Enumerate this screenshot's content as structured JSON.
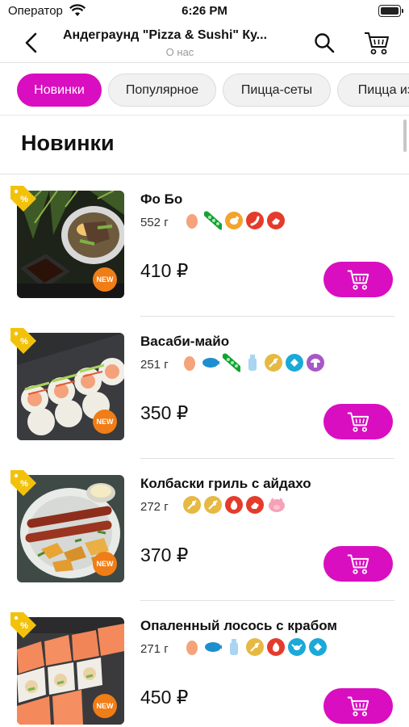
{
  "status_bar": {
    "carrier": "Оператор",
    "time": "6:26 PM"
  },
  "nav": {
    "title": "Андеграунд \"Pizza & Sushi\" Ку...",
    "subtitle": "О нас"
  },
  "categories": [
    "Новинки",
    "Популярное",
    "Пицца-сеты",
    "Пицца из"
  ],
  "section_title": "Новинки",
  "products": [
    {
      "name": "Фо Бо",
      "weight": "552 г",
      "price": "410 ₽",
      "badge": "NEW",
      "icons": [
        "egg",
        "pea",
        "chicken",
        "chili",
        "meat"
      ]
    },
    {
      "name": "Васаби-майо",
      "weight": "251 г",
      "price": "350 ₽",
      "badge": "NEW",
      "icons": [
        "egg",
        "fish",
        "pea",
        "milk",
        "wheat",
        "shellfish",
        "mushroom"
      ]
    },
    {
      "name": "Колбаски гриль с айдахо",
      "weight": "272 г",
      "price": "370 ₽",
      "badge": "NEW",
      "icons": [
        "wheat",
        "wheat",
        "fire",
        "meat",
        "pig"
      ]
    },
    {
      "name": "Опаленный лосось с крабом",
      "weight": "271 г",
      "price": "450 ₽",
      "badge": "NEW",
      "icons": [
        "egg",
        "fish",
        "milk",
        "wheat",
        "fire",
        "crab",
        "shellfish"
      ]
    }
  ],
  "colors": {
    "accent": "#d90ec0",
    "new_badge": "#f07d16",
    "promo_tag": "#f2c20b"
  }
}
